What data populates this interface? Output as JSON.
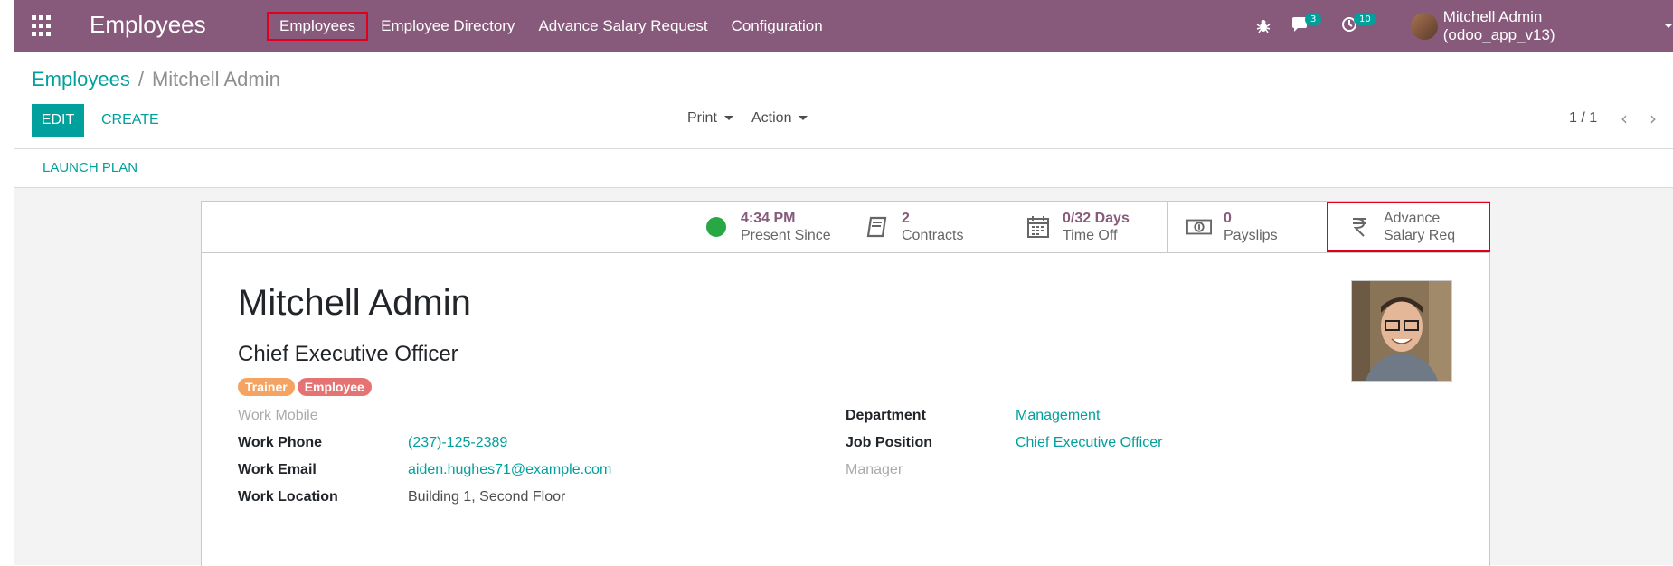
{
  "navbar": {
    "app_title": "Employees",
    "menu": [
      {
        "label": "Employees",
        "selected": true
      },
      {
        "label": "Employee Directory"
      },
      {
        "label": "Advance Salary Request"
      },
      {
        "label": "Configuration"
      }
    ],
    "messages_count": "3",
    "activities_count": "10",
    "user_label": "Mitchell Admin (odoo_app_v13)",
    "icons": [
      "apps-icon",
      "bug-icon",
      "chat-icon",
      "clock-icon",
      "avatar"
    ]
  },
  "breadcrumb": {
    "parent": "Employees",
    "separator": "/",
    "current": "Mitchell Admin"
  },
  "controls": {
    "edit": "EDIT",
    "create": "CREATE",
    "print": "Print",
    "action": "Action",
    "pager": "1 / 1"
  },
  "launch_plan": "LAUNCH PLAN",
  "smart_buttons": [
    {
      "value": "4:34 PM",
      "label": "Present Since",
      "icon": "presence-dot"
    },
    {
      "value": "2",
      "label": "Contracts",
      "icon": "book-icon"
    },
    {
      "value": "0/32 Days",
      "label": "Time Off",
      "icon": "calendar-icon"
    },
    {
      "value": "0",
      "label": "Payslips",
      "icon": "money-icon"
    },
    {
      "line1": "Advance",
      "line2": "Salary Req",
      "icon": "rupee-icon"
    }
  ],
  "employee": {
    "name": "Mitchell Admin",
    "job_title": "Chief Executive Officer",
    "tags": [
      {
        "label": "Trainer",
        "color": "#f4a460"
      },
      {
        "label": "Employee",
        "color": "#e57373"
      }
    ]
  },
  "fields_left": [
    {
      "label": "Work Mobile",
      "value": ""
    },
    {
      "label": "Work Phone",
      "value": "(237)-125-2389"
    },
    {
      "label": "Work Email",
      "value": "aiden.hughes71@example.com"
    },
    {
      "label": "Work Location",
      "value": "Building 1, Second Floor"
    }
  ],
  "fields_right": [
    {
      "label": "Department",
      "value": "Management"
    },
    {
      "label": "Job Position",
      "value": "Chief Executive Officer"
    },
    {
      "label": "Manager",
      "value": ""
    }
  ],
  "colors": {
    "brand": "#875a7b",
    "accent": "#00a09d",
    "highlight": "#e0001b"
  }
}
